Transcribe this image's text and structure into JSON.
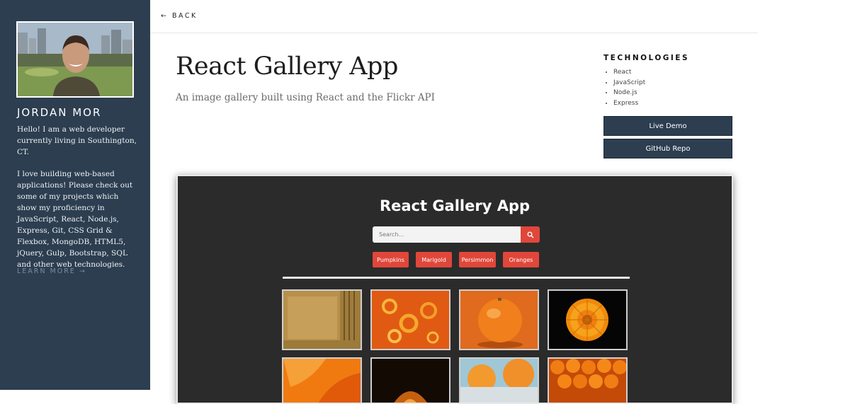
{
  "sidebar": {
    "name": "JORDAN MOR",
    "bio_p1": "Hello! I am a web developer currently living in Southington, CT.",
    "bio_p2": "I love building web-based applications! Please check out some of my projects which show my proficiency in JavaScript, React, Node.js, Express, Git, CSS Grid & Flexbox, MongoDB, HTML5, jQuery, Gulp, Bootstrap, SQL and other web technologies.",
    "learn_more": "LEARN MORE →"
  },
  "topbar": {
    "back": "← BACK"
  },
  "project": {
    "title": "React Gallery App",
    "subtitle": "An image gallery built using React and the Flickr API"
  },
  "technologies": {
    "heading": "TECHNOLOGIES",
    "items": [
      "React",
      "JavaScript",
      "Node.js",
      "Express"
    ]
  },
  "buttons": {
    "live_demo": "Live Demo",
    "github_repo": "GitHub Repo"
  },
  "preview": {
    "app_title": "React Gallery App",
    "search_placeholder": "Search...",
    "nav": [
      "Pumpkins",
      "Marigold",
      "Persimmon",
      "Oranges"
    ]
  },
  "colors": {
    "sidebar_bg": "#2c3e50",
    "accent_red": "#e0473a",
    "preview_bg": "#2b2b2b"
  },
  "icons": [
    "search-icon",
    "arrow-left-icon",
    "arrow-right-icon"
  ]
}
